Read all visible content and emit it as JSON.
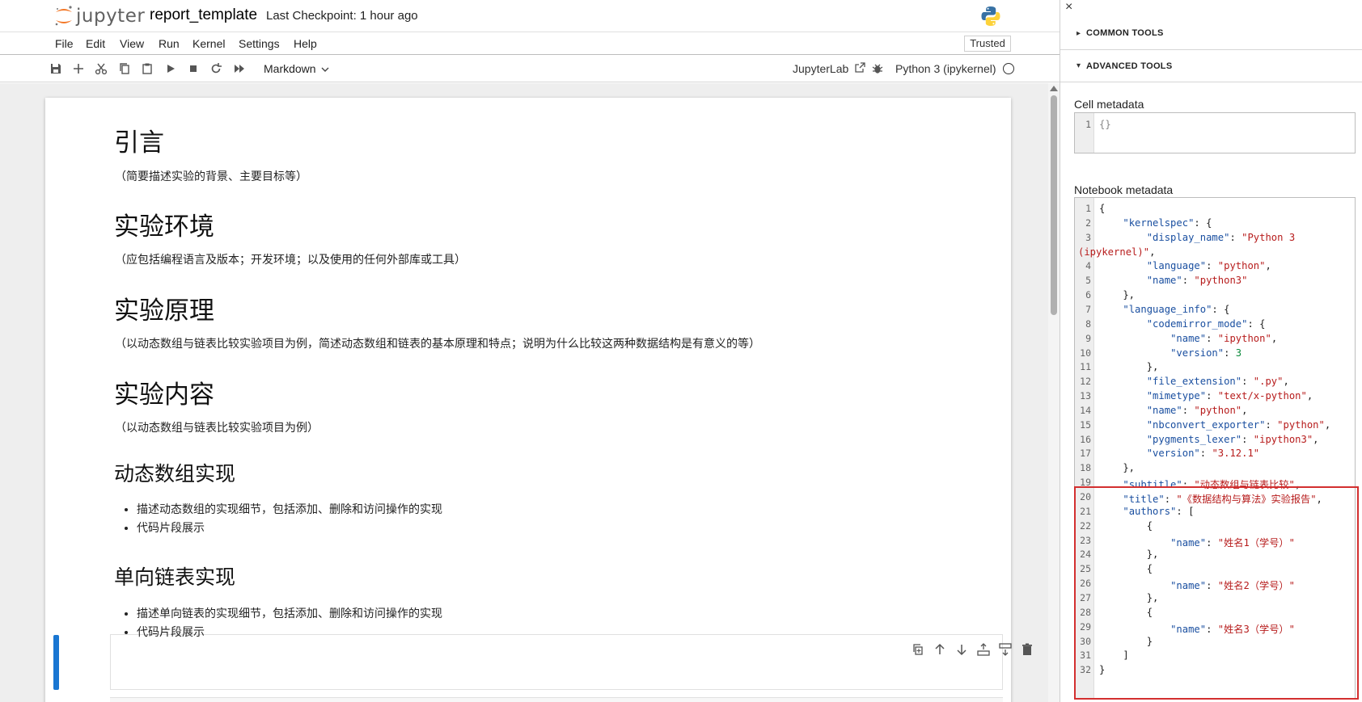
{
  "header": {
    "logo_text": "jupyter",
    "notebook_name": "report_template",
    "checkpoint": "Last Checkpoint: 1 hour ago",
    "trusted": "Trusted"
  },
  "menu": [
    "File",
    "Edit",
    "View",
    "Run",
    "Kernel",
    "Settings",
    "Help"
  ],
  "toolbar": {
    "cell_type": "Markdown",
    "jupyterlab_link": "JupyterLab",
    "kernel_name": "Python 3 (ipykernel)"
  },
  "notebook": {
    "cells": [
      {
        "kind": "h1",
        "text": "引言"
      },
      {
        "kind": "p",
        "text": "（简要描述实验的背景、主要目标等）"
      },
      {
        "kind": "h1",
        "text": "实验环境"
      },
      {
        "kind": "p",
        "text": "（应包括编程语言及版本；开发环境；以及使用的任何外部库或工具）"
      },
      {
        "kind": "h1",
        "text": "实验原理"
      },
      {
        "kind": "p",
        "text": "（以动态数组与链表比较实验项目为例，简述动态数组和链表的基本原理和特点；说明为什么比较这两种数据结构是有意义的等）"
      },
      {
        "kind": "h1",
        "text": "实验内容"
      },
      {
        "kind": "p",
        "text": "（以动态数组与链表比较实验项目为例）"
      },
      {
        "kind": "h2",
        "text": "动态数组实现"
      },
      {
        "kind": "li",
        "text": "描述动态数组的实现细节，包括添加、删除和访问操作的实现"
      },
      {
        "kind": "li",
        "text": "代码片段展示"
      },
      {
        "kind": "h2",
        "text": "单向链表实现"
      },
      {
        "kind": "li",
        "text": "描述单向链表的实现细节，包括添加、删除和访问操作的实现"
      },
      {
        "kind": "li",
        "text": "代码片段展示"
      }
    ]
  },
  "inspector": {
    "close": "×",
    "common_tools": "COMMON TOOLS",
    "advanced_tools": "ADVANCED TOOLS",
    "cell_metadata_label": "Cell metadata",
    "cell_metadata_lines": [
      "{}"
    ],
    "notebook_metadata_label": "Notebook metadata",
    "notebook_metadata_lines": [
      "{",
      "    \"kernelspec\": {",
      "        \"display_name\": \"Python 3",
      "(ipykernel)\",",
      "        \"language\": \"python\",",
      "        \"name\": \"python3\"",
      "    },",
      "    \"language_info\": {",
      "        \"codemirror_mode\": {",
      "            \"name\": \"ipython\",",
      "            \"version\": 3",
      "        },",
      "        \"file_extension\": \".py\",",
      "        \"mimetype\": \"text/x-python\",",
      "        \"name\": \"python\",",
      "        \"nbconvert_exporter\": \"python\",",
      "        \"pygments_lexer\": \"ipython3\",",
      "        \"version\": \"3.12.1\"",
      "    },",
      "    \"subtitle\": \"动态数组与链表比较\",",
      "    \"title\": \"《数据结构与算法》实验报告\",",
      "    \"authors\": [",
      "        {",
      "            \"name\": \"姓名1（学号）\"",
      "        },",
      "        {",
      "            \"name\": \"姓名2（学号）\"",
      "        },",
      "        {",
      "            \"name\": \"姓名3（学号）\"",
      "        }",
      "    ]",
      "}"
    ],
    "notebook_metadata_line_numbers": [
      "1",
      "2",
      "3",
      "",
      "4",
      "5",
      "6",
      "7",
      "8",
      "9",
      "10",
      "11",
      "12",
      "13",
      "14",
      "15",
      "16",
      "17",
      "18",
      "19",
      "20",
      "21",
      "22",
      "23",
      "24",
      "25",
      "26",
      "27",
      "28",
      "29",
      "30",
      "31",
      "32"
    ]
  },
  "colors": {
    "accent": "#1976d2",
    "highlight_box": "#d32f2f",
    "jupyter_orange": "#f37726"
  },
  "icons": [
    "save-icon",
    "add-cell-icon",
    "cut-icon",
    "copy-icon",
    "paste-icon",
    "run-icon",
    "stop-icon",
    "restart-icon",
    "fast-forward-icon",
    "chevron-down-icon",
    "external-link-icon",
    "bug-icon",
    "kernel-status-icon",
    "duplicate-icon",
    "move-up-icon",
    "move-down-icon",
    "insert-above-icon",
    "insert-below-icon",
    "delete-icon",
    "close-icon",
    "caret-right-icon",
    "caret-down-icon",
    "python-logo-icon"
  ]
}
